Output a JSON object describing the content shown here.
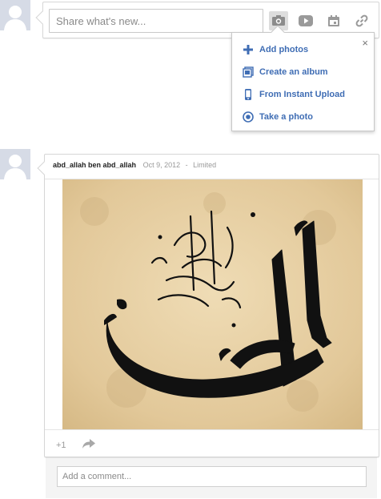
{
  "composer": {
    "placeholder": "Share what's new...",
    "icons": [
      "camera-icon",
      "video-icon",
      "event-icon",
      "link-icon"
    ]
  },
  "photo_menu": {
    "close_label": "×",
    "items": [
      {
        "label": "Add photos",
        "icon": "plus-icon"
      },
      {
        "label": "Create an album",
        "icon": "album-icon"
      },
      {
        "label": "From Instant Upload",
        "icon": "phone-icon"
      },
      {
        "label": "Take a photo",
        "icon": "webcam-icon"
      }
    ]
  },
  "post": {
    "author": "abd_allah ben abd_allah",
    "date": "Oct 9, 2012",
    "separator": "-",
    "visibility": "Limited",
    "image_alt": "arabic-calligraphy-image",
    "plus_one_label": "+1",
    "share_icon": "share-arrow-icon"
  },
  "comments": {
    "placeholder": "Add a comment..."
  },
  "colors": {
    "link_blue": "#3f6db4",
    "icon_gray": "#8c8c8c",
    "parchment": "#e8d3a6",
    "ink": "#111111"
  }
}
